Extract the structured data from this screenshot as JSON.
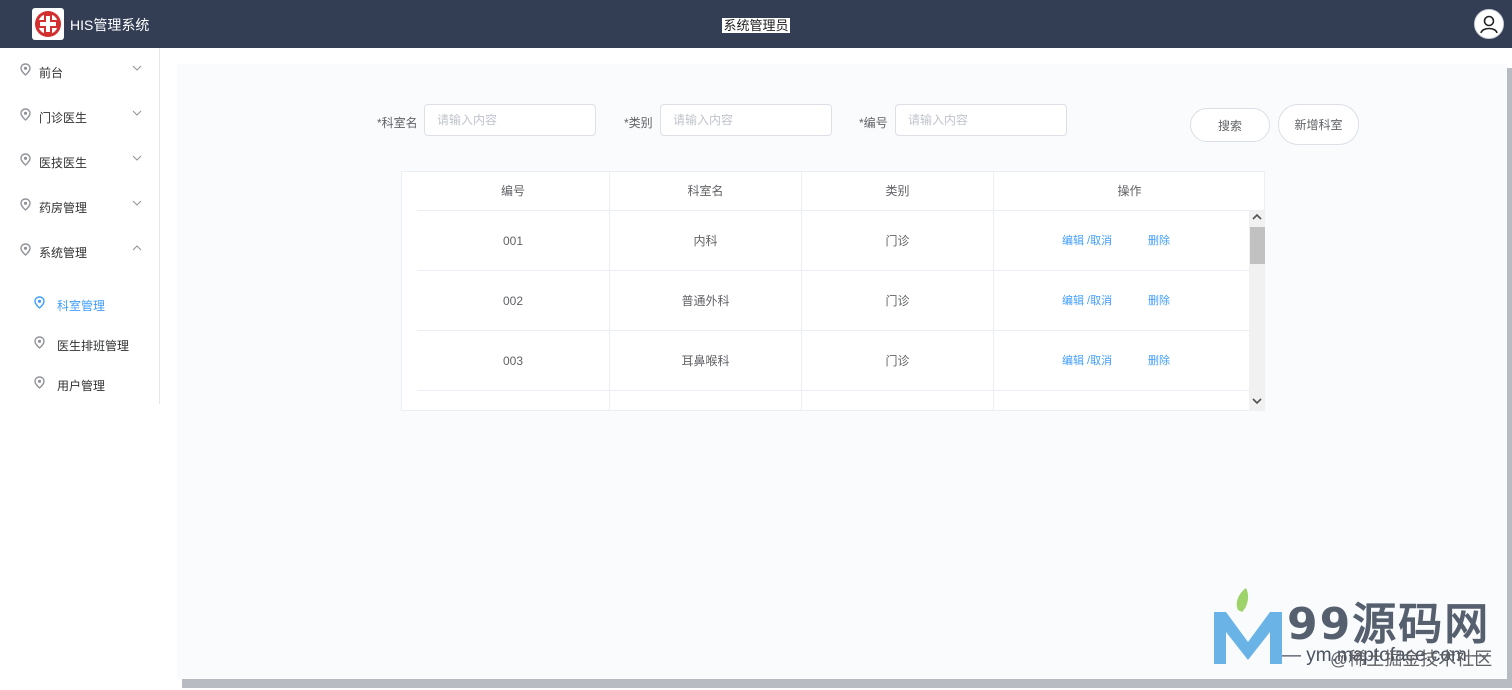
{
  "header": {
    "app_title": "HIS管理系统",
    "center_title": "系统管理员",
    "logo_icon": "red-cross-logo-icon",
    "avatar_icon": "user-avatar-icon",
    "bg_color": "#333e55"
  },
  "sidebar": {
    "menus": [
      {
        "label": "前台",
        "expanded": false
      },
      {
        "label": "门诊医生",
        "expanded": false
      },
      {
        "label": "医技医生",
        "expanded": false
      },
      {
        "label": "药房管理",
        "expanded": false
      },
      {
        "label": "系统管理",
        "expanded": true
      }
    ],
    "submenus": [
      {
        "label": "科室管理",
        "active": true
      },
      {
        "label": "医生排班管理",
        "active": false
      },
      {
        "label": "用户管理",
        "active": false
      }
    ],
    "accent_color": "#409eff"
  },
  "filters": {
    "dept_label": "*科室名",
    "dept_placeholder": "请输入内容",
    "type_label": "*类别",
    "type_placeholder": "请输入内容",
    "code_label": "*编号",
    "code_placeholder": "请输入内容",
    "search_button": "搜索",
    "add_button": "新增科室"
  },
  "table": {
    "columns": [
      "编号",
      "科室名",
      "类别",
      "操作"
    ],
    "rows": [
      {
        "code": "001",
        "name": "内科",
        "type": "门诊",
        "edit": "编辑 /取消",
        "delete": "删除"
      },
      {
        "code": "002",
        "name": "普通外科",
        "type": "门诊",
        "edit": "编辑 /取消",
        "delete": "删除"
      },
      {
        "code": "003",
        "name": "耳鼻喉科",
        "type": "门诊",
        "edit": "编辑 /取消",
        "delete": "删除"
      }
    ]
  },
  "watermark": {
    "big": "99源码网",
    "small": "— ym.maptoface.com —",
    "credit": "@稀土掘金技术社区"
  }
}
